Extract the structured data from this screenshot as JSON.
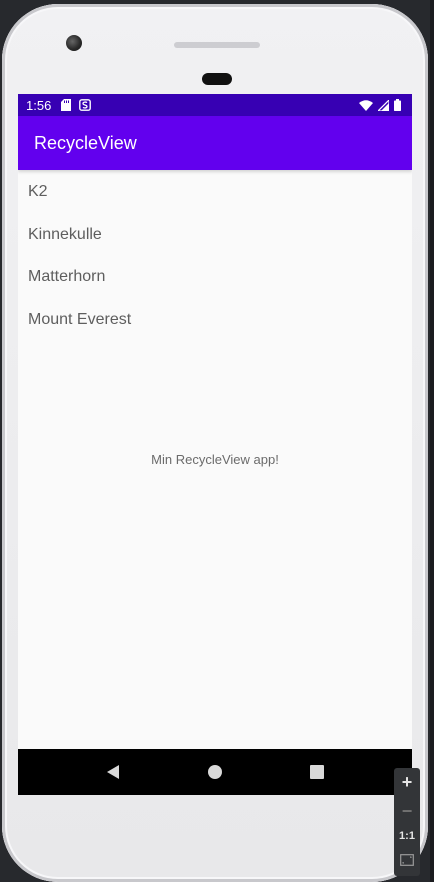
{
  "status_bar": {
    "time": "1:56",
    "background_color": "#3700b3",
    "left_icons": [
      "sd-card-icon",
      "notification-s-icon"
    ],
    "right_icons": [
      "wifi-icon",
      "signal-icon",
      "battery-icon"
    ]
  },
  "app_bar": {
    "title": "RecycleView",
    "background_color": "#6200ee"
  },
  "list": {
    "items": [
      "K2",
      "Kinnekulle",
      "Matterhorn",
      "Mount Everest"
    ]
  },
  "center_text": "Min RecycleView app!",
  "nav_bar": {
    "buttons": [
      "back-icon",
      "home-icon",
      "overview-icon"
    ]
  },
  "zoom_controls": {
    "zoom_in": "+",
    "zoom_out": "−",
    "one_to_one": "1:1",
    "fit_icon": "fit-screen-icon"
  }
}
